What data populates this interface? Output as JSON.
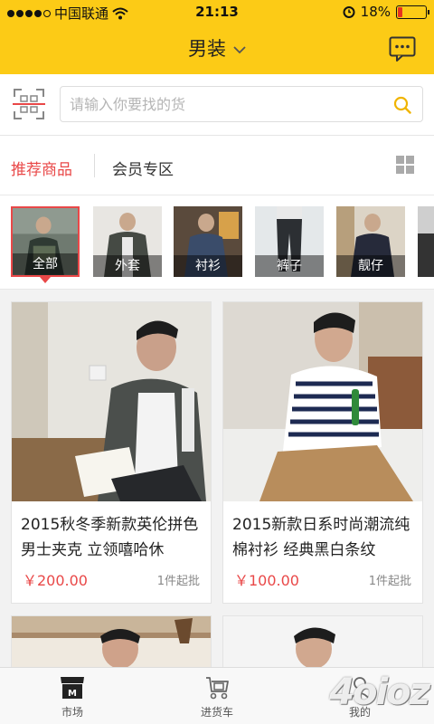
{
  "status_bar": {
    "carrier": "中国联通",
    "time": "21:13",
    "battery": "18%",
    "battery_level": 0.18,
    "signal_bars": 4
  },
  "nav": {
    "title": "男装",
    "icons": [
      "chevron-down-icon",
      "message-icon"
    ]
  },
  "search": {
    "placeholder": "请输入你要找的货",
    "icons": [
      "scan-icon",
      "search-icon"
    ]
  },
  "tabs": {
    "recommended": "推荐商品",
    "member": "会员专区",
    "layout_icon": "grid-icon"
  },
  "categories": [
    {
      "label": "全部",
      "active": true
    },
    {
      "label": "外套",
      "active": false
    },
    {
      "label": "衬衫",
      "active": false
    },
    {
      "label": "裤子",
      "active": false
    },
    {
      "label": "靓仔",
      "active": false
    }
  ],
  "products": [
    {
      "name": "2015秋冬季新款英伦拼色男士夹克 立领嘻哈休",
      "price": "￥200.00",
      "min_qty": "1件起批"
    },
    {
      "name": "2015新款日系时尚潮流纯棉衬衫 经典黑白条纹",
      "price": "￥100.00",
      "min_qty": "1件起批"
    }
  ],
  "bottom_nav": [
    {
      "label": "市场",
      "icon": "market-icon"
    },
    {
      "label": "进货车",
      "icon": "cart-icon"
    },
    {
      "label": "我的",
      "icon": "user-icon"
    }
  ],
  "watermark": "4oioz",
  "colors": {
    "header": "#fccb16",
    "accent_red": "#e94848"
  }
}
